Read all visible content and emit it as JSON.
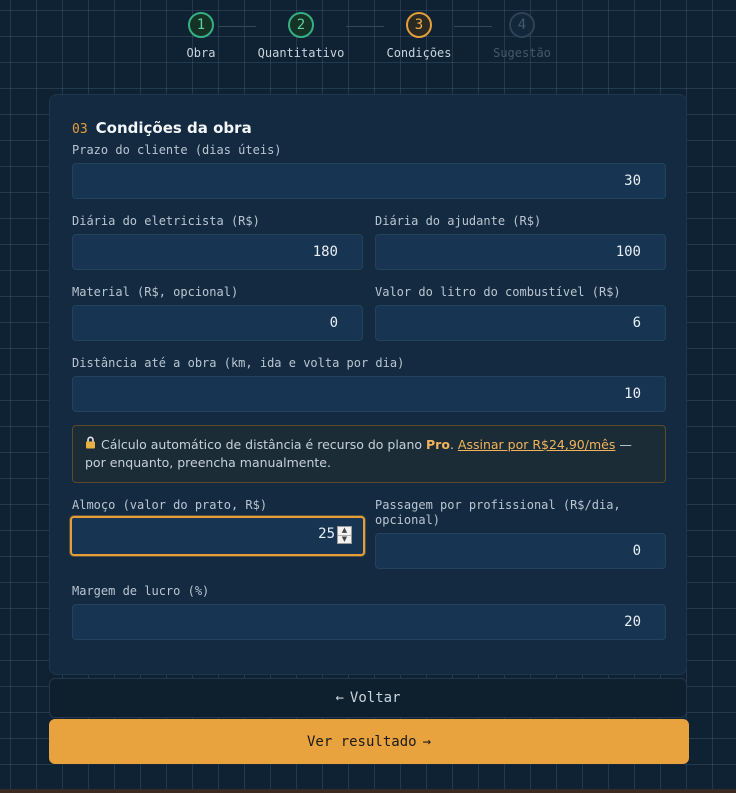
{
  "stepper": {
    "steps": [
      {
        "number": "1",
        "label": "Obra",
        "state": "done"
      },
      {
        "number": "2",
        "label": "Quantitativo",
        "state": "done"
      },
      {
        "number": "3",
        "label": "Condições",
        "state": "active"
      },
      {
        "number": "4",
        "label": "Sugestão",
        "state": "todo"
      }
    ]
  },
  "section": {
    "number": "03",
    "title": "Condições da obra"
  },
  "fields": {
    "prazo": {
      "label": "Prazo do cliente (dias úteis)",
      "value": "30"
    },
    "diaria_eletricista": {
      "label": "Diária do eletricista (R$)",
      "value": "180"
    },
    "diaria_ajudante": {
      "label": "Diária do ajudante (R$)",
      "value": "100"
    },
    "material": {
      "label": "Material (R$, opcional)",
      "value": "0"
    },
    "combustivel": {
      "label": "Valor do litro do combustível (R$)",
      "value": "6"
    },
    "distancia": {
      "label": "Distância até a obra (km, ida e volta por dia)",
      "value": "10"
    },
    "almoco": {
      "label": "Almoço (valor do prato, R$)",
      "value": "25"
    },
    "passagem": {
      "label_line1": "Passagem por profissional (R$/dia,",
      "label_line2": "opcional)",
      "value": "0"
    },
    "margem": {
      "label": "Margem de lucro (%)",
      "value": "20"
    }
  },
  "notice": {
    "icon": "lock-icon",
    "text_before": "Cálculo automático de distância é recurso do plano ",
    "plan": "Pro",
    "dot": ". ",
    "link": "Assinar por R$24,90/mês",
    "text_after": " — por enquanto, preencha manualmente."
  },
  "buttons": {
    "back_arrow": "←",
    "back_label": "Voltar",
    "next_label": "Ver resultado",
    "next_arrow": "→"
  },
  "colors": {
    "accent": "#e8a23e",
    "done": "#35b083",
    "background": "#0f2233",
    "card": "#132a40"
  }
}
